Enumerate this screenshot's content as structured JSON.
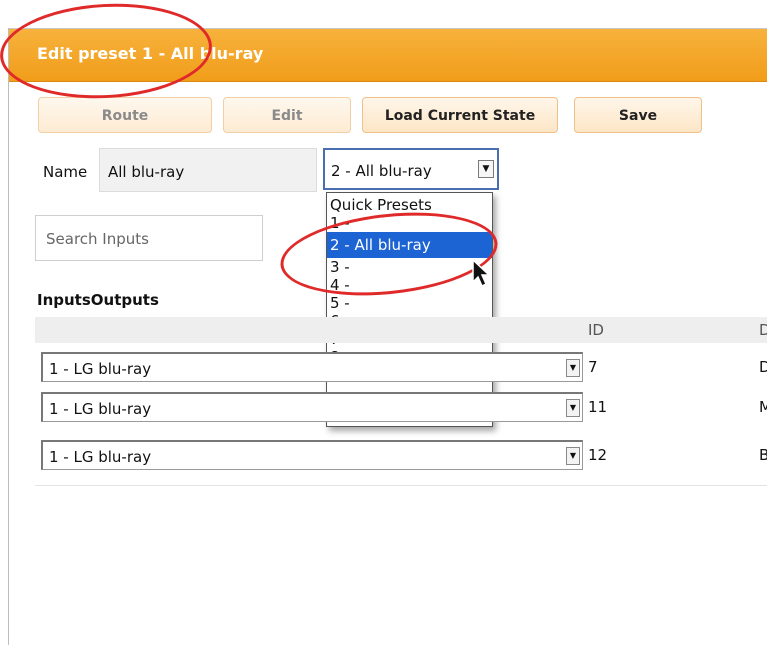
{
  "window": {
    "title": "Edit preset 1 - All blu-ray"
  },
  "toolbar": {
    "route_label": "Route",
    "edit_label": "Edit",
    "load_label": "Load Current State",
    "save_label": "Save"
  },
  "name_field": {
    "label": "Name",
    "value": "All blu-ray"
  },
  "preset_select": {
    "selected": "2 - All blu-ray",
    "options": [
      "Quick Presets",
      "1 -",
      "2 - All blu-ray",
      "3 -",
      "4 -",
      "5 -",
      "6 -",
      "7 -",
      "8 -"
    ]
  },
  "search": {
    "placeholder": "Search Inputs"
  },
  "io": {
    "inputs_label": "Inputs",
    "outputs_label": "Outputs"
  },
  "table": {
    "columns": {
      "id": "ID",
      "d": "D"
    },
    "rows": [
      {
        "input": "1 - LG blu-ray",
        "id": "7",
        "d": "D"
      },
      {
        "input": "1 - LG blu-ray",
        "id": "11",
        "d": "M"
      },
      {
        "input": "1 - LG blu-ray",
        "id": "12",
        "d": "B"
      }
    ]
  },
  "colors": {
    "title_bar": "#f19d1a",
    "selection": "#1c63d3",
    "annotation": "#e02a2a"
  }
}
